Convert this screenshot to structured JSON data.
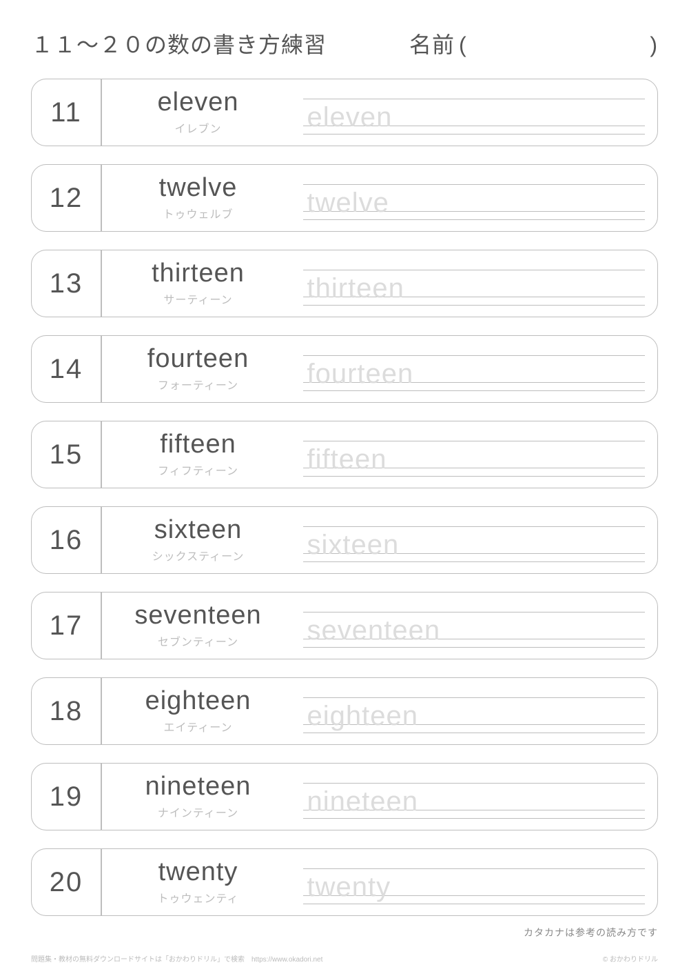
{
  "header": {
    "title": "１１～２０の数の書き方練習",
    "name_label": "名前",
    "paren_open": "(",
    "paren_close": ")"
  },
  "rows": [
    {
      "num": "11",
      "en": "eleven",
      "kana": "イレブン",
      "trace": "eleven"
    },
    {
      "num": "12",
      "en": "twelve",
      "kana": "トゥウェルブ",
      "trace": "twelve"
    },
    {
      "num": "13",
      "en": "thirteen",
      "kana": "サーティーン",
      "trace": "thirteen"
    },
    {
      "num": "14",
      "en": "fourteen",
      "kana": "フォーティーン",
      "trace": "fourteen"
    },
    {
      "num": "15",
      "en": "fifteen",
      "kana": "フィフティーン",
      "trace": "fifteen"
    },
    {
      "num": "16",
      "en": "sixteen",
      "kana": "シックスティーン",
      "trace": "sixteen"
    },
    {
      "num": "17",
      "en": "seventeen",
      "kana": "セブンティーン",
      "trace": "seventeen"
    },
    {
      "num": "18",
      "en": "eighteen",
      "kana": "エイティーン",
      "trace": "eighteen"
    },
    {
      "num": "19",
      "en": "nineteen",
      "kana": "ナインティーン",
      "trace": "nineteen"
    },
    {
      "num": "20",
      "en": "twenty",
      "kana": "トゥウェンティ",
      "trace": "twenty"
    }
  ],
  "footnote": "カタカナは参考の読み方です",
  "footer": {
    "left": "問題集・教材の無料ダウンロードサイトは「おかわりドリル」で検索　https://www.okadori.net",
    "right": "© おかわりドリル"
  }
}
